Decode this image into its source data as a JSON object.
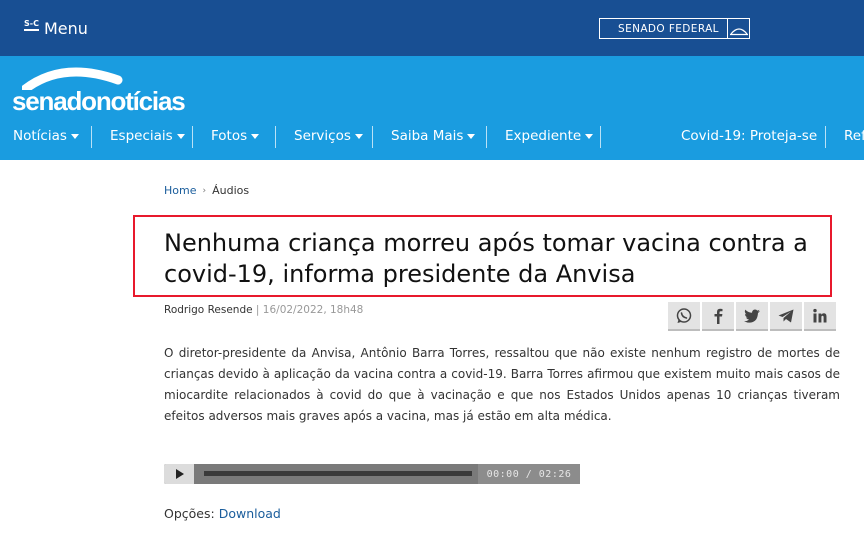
{
  "topbar": {
    "logo_text": "S-C",
    "menu_label": "Menu",
    "senado_federal": "SENADO FEDERAL"
  },
  "header": {
    "logo_text": "senadonotícias",
    "nav": [
      {
        "label": "Notícias",
        "dropdown": true
      },
      {
        "label": "Especiais",
        "dropdown": true
      },
      {
        "label": "Fotos",
        "dropdown": true
      },
      {
        "label": "Serviços",
        "dropdown": true
      },
      {
        "label": "Saiba Mais",
        "dropdown": true
      },
      {
        "label": "Expediente",
        "dropdown": true
      },
      {
        "label": "Covid-19: Proteja-se",
        "dropdown": false
      },
      {
        "label": "Ref",
        "dropdown": false
      }
    ]
  },
  "breadcrumb": {
    "home": "Home",
    "separator": "›",
    "current": "Áudios"
  },
  "article": {
    "title": "Nenhuma criança morreu após tomar vacina contra a covid-19, informa presidente da Anvisa",
    "author": "Rodrigo Resende",
    "byline_sep": " | ",
    "date": "16/02/2022, 18h48",
    "body": "O diretor-presidente da Anvisa, Antônio Barra Torres, ressaltou que não existe nenhum registro de mortes de crianças devido à aplicação da vacina contra a covid-19. Barra Torres afirmou que existem muito mais casos de miocardite relacionados à covid do que à vacinação e que nos Estados Unidos apenas 10 crianças tiveram efeitos adversos mais graves após a vacina, mas já estão em alta médica."
  },
  "share": [
    "whatsapp-icon",
    "facebook-icon",
    "twitter-icon",
    "telegram-icon",
    "linkedin-icon"
  ],
  "player": {
    "time": "00:00 / 02:26",
    "progress": 0
  },
  "options": {
    "label": "Opções:",
    "download": "Download"
  },
  "colors": {
    "topbar": "#184f93",
    "header": "#1a9ce0",
    "highlight_border": "#e8192c",
    "link": "#1a5d9c"
  }
}
